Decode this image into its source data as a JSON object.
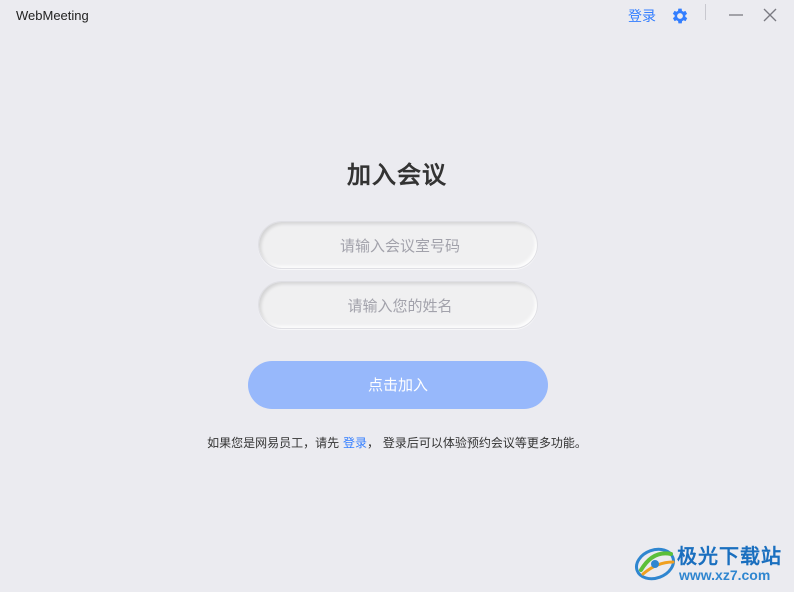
{
  "app": {
    "title": "WebMeeting"
  },
  "header": {
    "login_label": "登录",
    "settings_icon": "gear-icon",
    "minimize_icon": "minimize-icon",
    "close_icon": "close-icon"
  },
  "main": {
    "title": "加入会议",
    "meeting_id_input": {
      "placeholder": "请输入会议室号码",
      "value": ""
    },
    "name_input": {
      "placeholder": "请输入您的姓名",
      "value": ""
    },
    "join_button_label": "点击加入",
    "footnote": {
      "before": "如果您是网易员工，请先 ",
      "link": "登录",
      "after": "， 登录后可以体验预约会议等更多功能。"
    }
  },
  "watermark": {
    "site_name": "极光下载站",
    "url": "www.xz7.com"
  },
  "colors": {
    "accent": "#337eff",
    "button_disabled": "#97b8fb",
    "background": "#ebebf0"
  }
}
